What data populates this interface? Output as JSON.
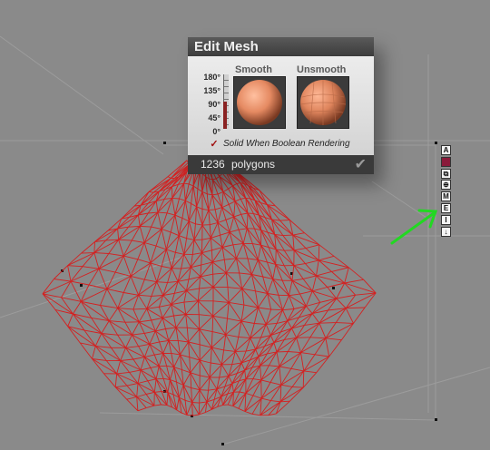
{
  "panel": {
    "title": "Edit Mesh",
    "angle_labels": [
      "180°",
      "135°",
      "90°",
      "45°",
      "0°"
    ],
    "angle_value_deg": 90,
    "smooth_label": "Smooth",
    "unsmooth_label": "Unsmooth",
    "checkbox_checked": true,
    "checkbox_label": "Solid When Boolean Rendering",
    "polygon_count": "1236",
    "polygon_word": "polygons",
    "ok_icon": "checkmark-icon"
  },
  "side_toolbar": [
    {
      "name": "tool-a",
      "glyph": "A"
    },
    {
      "name": "tool-color",
      "glyph": ""
    },
    {
      "name": "tool-group",
      "glyph": "⧉"
    },
    {
      "name": "tool-center",
      "glyph": "⊕"
    },
    {
      "name": "tool-m",
      "glyph": "M"
    },
    {
      "name": "tool-e",
      "glyph": "E"
    },
    {
      "name": "tool-i",
      "glyph": "I"
    },
    {
      "name": "tool-down",
      "glyph": "↓"
    }
  ],
  "colors": {
    "mesh": "#d42020",
    "annotation_arrow": "#22d822",
    "shape_color_swatch": "#8a1a3a"
  }
}
